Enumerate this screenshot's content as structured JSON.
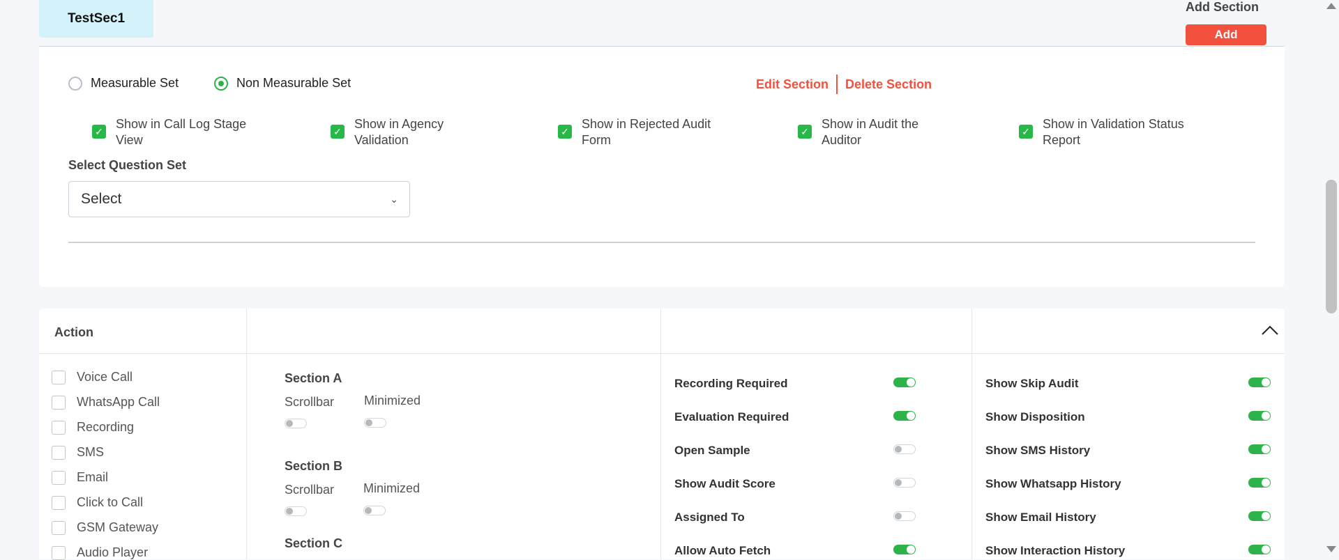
{
  "section_tab": {
    "label": "TestSec1"
  },
  "add_section": {
    "label": "Add Section",
    "button": "Add"
  },
  "set_type": {
    "options": [
      {
        "label": "Measurable Set",
        "selected": false
      },
      {
        "label": "Non Measurable Set",
        "selected": true
      }
    ]
  },
  "section_actions": {
    "edit": "Edit Section",
    "delete": "Delete Section"
  },
  "show_in_options": [
    {
      "line1": "Show in Call Log Stage",
      "line2": "View",
      "checked": true
    },
    {
      "line1": "Show in Agency",
      "line2": "Validation",
      "checked": true
    },
    {
      "line1": "Show in Rejected Audit",
      "line2": "Form",
      "checked": true
    },
    {
      "line1": "Show in Audit the",
      "line2": "Auditor",
      "checked": true
    },
    {
      "line1": "Show in Validation Status",
      "line2": "Report",
      "checked": true
    }
  ],
  "question_set": {
    "label": "Select Question Set",
    "value": "Select"
  },
  "action_panel": {
    "header": "Action",
    "items": [
      {
        "label": "Voice Call",
        "checked": false
      },
      {
        "label": "WhatsApp Call",
        "checked": false
      },
      {
        "label": "Recording",
        "checked": false
      },
      {
        "label": "SMS",
        "checked": false
      },
      {
        "label": "Email",
        "checked": false
      },
      {
        "label": "Click to Call",
        "checked": false
      },
      {
        "label": "GSM Gateway",
        "checked": false
      },
      {
        "label": "Audio Player",
        "checked": false
      }
    ]
  },
  "sections": [
    {
      "name": "Section A",
      "scrollbar_label": "Scrollbar",
      "minimized_label": "Minimized",
      "scrollbar_on": false,
      "minimized_on": false
    },
    {
      "name": "Section B",
      "scrollbar_label": "Scrollbar",
      "minimized_label": "Minimized",
      "scrollbar_on": false,
      "minimized_on": false
    },
    {
      "name": "Section C"
    }
  ],
  "settings_col1": [
    {
      "label": "Recording Required",
      "on": true
    },
    {
      "label": "Evaluation Required",
      "on": true
    },
    {
      "label": "Open Sample",
      "on": false
    },
    {
      "label": "Show Audit Score",
      "on": false
    },
    {
      "label": "Assigned To",
      "on": false
    },
    {
      "label": "Allow Auto Fetch",
      "on": true
    }
  ],
  "settings_col2": [
    {
      "label": "Show Skip Audit",
      "on": true
    },
    {
      "label": "Show Disposition",
      "on": true
    },
    {
      "label": "Show SMS History",
      "on": true
    },
    {
      "label": "Show Whatsapp History",
      "on": true
    },
    {
      "label": "Show Email History",
      "on": true
    },
    {
      "label": "Show Interaction History",
      "on": true
    }
  ],
  "colors": {
    "accent_red": "#f2513d",
    "accent_green": "#2db34a",
    "tab_bg": "#d3f2fa"
  }
}
